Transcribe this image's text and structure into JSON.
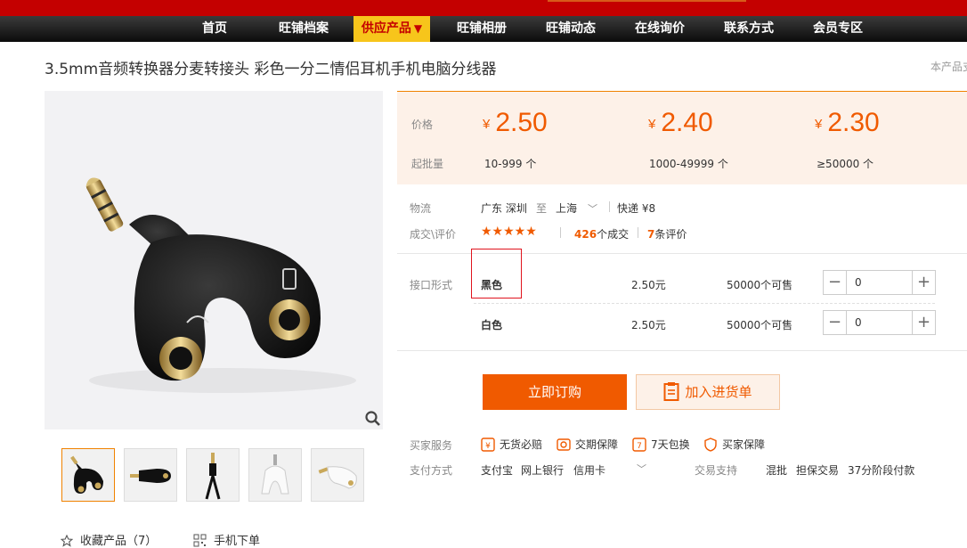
{
  "colors": {
    "brand_red": "#c40000",
    "accent_orange": "#f05a00",
    "nav_active": "#f7c51b",
    "panel_bg": "#fdf1e8"
  },
  "nav": {
    "items": [
      {
        "label": "首页"
      },
      {
        "label": "旺铺档案"
      },
      {
        "label": "供应产品",
        "active": true,
        "caret": "▼"
      },
      {
        "label": "旺铺相册"
      },
      {
        "label": "旺铺动态"
      },
      {
        "label": "在线询价"
      },
      {
        "label": "联系方式"
      },
      {
        "label": "会员专区"
      }
    ]
  },
  "product": {
    "title": "3.5mm音频转换器分麦转接头 彩色一分二情侣耳机手机电脑分线器",
    "report_text": "本产品支"
  },
  "gallery": {
    "thumb_count": 5,
    "zoom_icon": "magnifier-icon"
  },
  "bottom_links": {
    "favorite": "收藏产品（7）",
    "mobile": "手机下单"
  },
  "pricing": {
    "price_label": "价格",
    "moq_label": "起批量",
    "currency": "¥",
    "tiers": [
      {
        "price": "2.50",
        "qty": "10-999 个"
      },
      {
        "price": "2.40",
        "qty": "1000-49999 个"
      },
      {
        "price": "2.30",
        "qty": "≥50000 个"
      }
    ]
  },
  "logistics": {
    "label": "物流",
    "from": "广东 深圳",
    "to_word": "至",
    "dest": "上海",
    "shipping": "快递 ¥8"
  },
  "reviews": {
    "label": "成交\\评价",
    "stars": "★★★★★",
    "deals_count": "426",
    "deals_suffix": "个成交",
    "reviews_count": "7",
    "reviews_suffix": "条评价"
  },
  "sku": {
    "label": "接口形式",
    "options": [
      {
        "name": "黑色",
        "price": "2.50元",
        "stock": "50000个可售",
        "qty": "0"
      },
      {
        "name": "白色",
        "price": "2.50元",
        "stock": "50000个可售",
        "qty": "0"
      }
    ]
  },
  "actions": {
    "buy": "立即订购",
    "cart": "加入进货单"
  },
  "services": {
    "label": "买家服务",
    "items": [
      "无货必赔",
      "交期保障",
      "7天包换",
      "买家保障"
    ]
  },
  "payment": {
    "label": "支付方式",
    "methods": [
      "支付宝",
      "网上银行",
      "信用卡"
    ],
    "trade_label": "交易支持",
    "trade_items": [
      "混批",
      "担保交易",
      "37分阶段付款"
    ]
  }
}
